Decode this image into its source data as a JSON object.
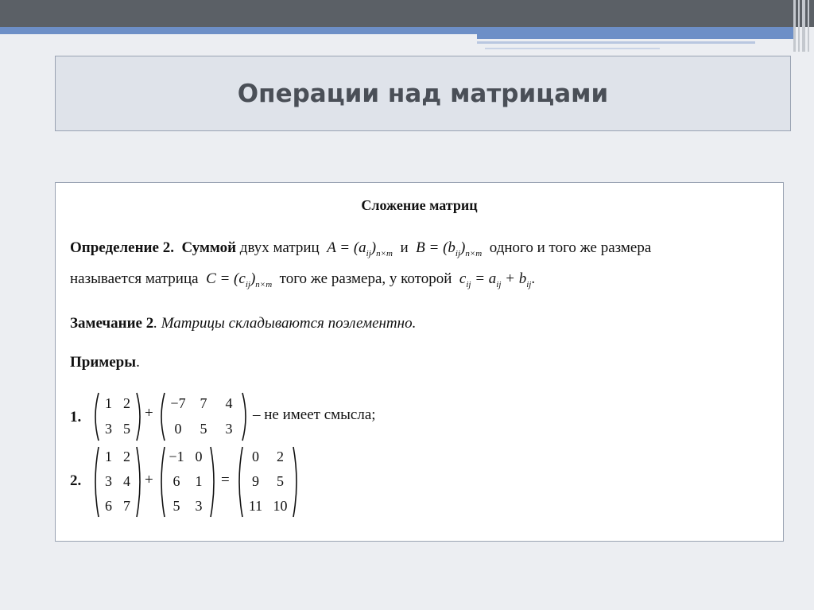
{
  "slide": {
    "title": "Операции над матрицами"
  },
  "content": {
    "heading": "Сложение матриц",
    "definition": {
      "label": "Определение 2.",
      "term": "Суммой",
      "text1": "двух матриц",
      "formula_a": "A = (a",
      "sub_a": "ij",
      "dim": "n×m",
      "conj": "и",
      "formula_b": "B = (b",
      "sub_b": "ij",
      "text2": "одного и того же размера",
      "text3": "называется матрица",
      "formula_c": "C = (c",
      "sub_c": "ij",
      "text4": "того же размера, у которой",
      "formula_sum_c": "c",
      "formula_sum_eq": "= a",
      "formula_sum_plus": "+ b",
      "period": "."
    },
    "remark": {
      "label": "Замечание 2",
      "text": ". Матрицы складываются поэлементно."
    },
    "examples": {
      "label": "Примеры",
      "dot": ".",
      "ex1_number": "1.",
      "ex1_text": "– не имеет смысла;",
      "ex2_number": "2.",
      "plus": "+",
      "equals": "=",
      "m1": [
        [
          "1",
          "2"
        ],
        [
          "3",
          "5"
        ]
      ],
      "m2": [
        [
          "−7",
          "7",
          "4"
        ],
        [
          "0",
          "5",
          "3"
        ]
      ],
      "m3": [
        [
          "1",
          "2"
        ],
        [
          "3",
          "4"
        ],
        [
          "6",
          "7"
        ]
      ],
      "m4": [
        [
          "−1",
          "0"
        ],
        [
          "6",
          "1"
        ],
        [
          "5",
          "3"
        ]
      ],
      "m5": [
        [
          "0",
          "2"
        ],
        [
          "9",
          "5"
        ],
        [
          "11",
          "10"
        ]
      ]
    }
  }
}
